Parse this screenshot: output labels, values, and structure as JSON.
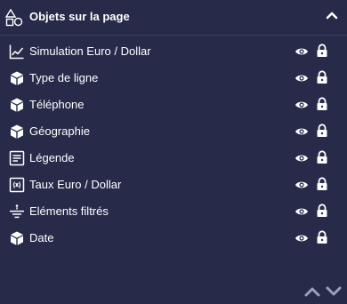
{
  "panel": {
    "title": "Objets sur la page",
    "title_icon": "shapes-icon",
    "collapse_icon": "chevron-up-icon"
  },
  "items": [
    {
      "label": "Simulation Euro / Dollar",
      "icon": "line-chart-icon"
    },
    {
      "label": "Type de ligne",
      "icon": "cube-icon"
    },
    {
      "label": "Téléphone",
      "icon": "cube-icon"
    },
    {
      "label": "Géographie",
      "icon": "cube-icon"
    },
    {
      "label": "Légende",
      "icon": "legend-icon"
    },
    {
      "label": "Taux Euro / Dollar",
      "icon": "variable-icon"
    },
    {
      "label": "Eléments filtrés",
      "icon": "filter-icon"
    },
    {
      "label": "Date",
      "icon": "cube-icon"
    }
  ],
  "colors": {
    "background": "#272b49",
    "divider": "#3a3f63",
    "foreground": "#ffffff"
  }
}
